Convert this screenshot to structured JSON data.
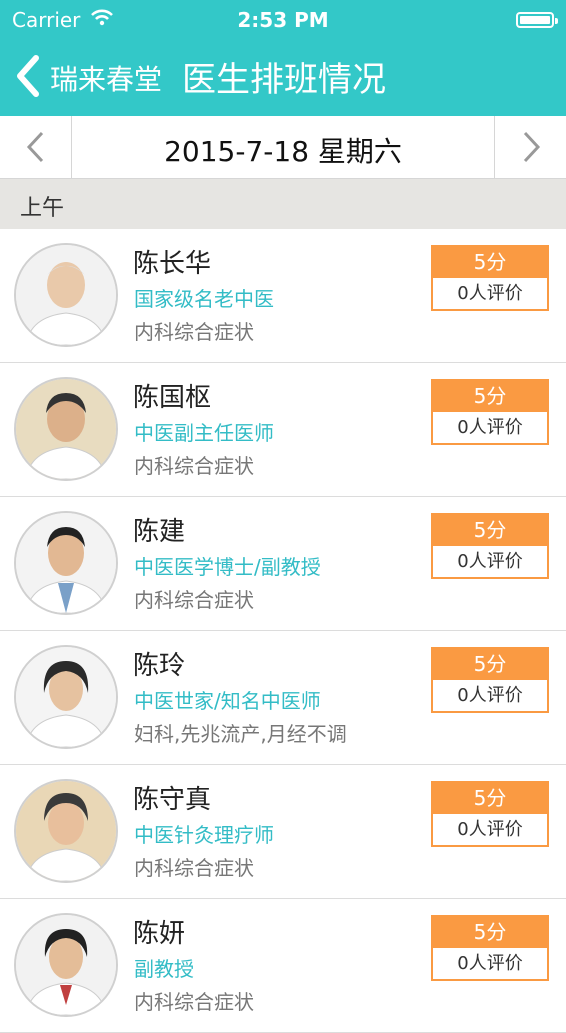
{
  "status_bar": {
    "carrier": "Carrier",
    "time": "2:53 PM"
  },
  "nav": {
    "back_label": "瑞来春堂",
    "title": "医生排班情况"
  },
  "date_bar": {
    "date": "2015-7-18 星期六"
  },
  "section": {
    "label": "上午"
  },
  "colors": {
    "header": "#33c8c8",
    "accent_text": "#33bcc6",
    "rating": "#fa9a42"
  },
  "doctors": [
    {
      "name": "陈长华",
      "title": "国家级名老中医",
      "specialty": "内科综合症状",
      "score": "5分",
      "reviews": "0人评价"
    },
    {
      "name": "陈国枢",
      "title": "中医副主任医师",
      "specialty": "内科综合症状",
      "score": "5分",
      "reviews": "0人评价"
    },
    {
      "name": "陈建",
      "title": "中医医学博士/副教授",
      "specialty": "内科综合症状",
      "score": "5分",
      "reviews": "0人评价"
    },
    {
      "name": "陈玲",
      "title": "中医世家/知名中医师",
      "specialty": "妇科,先兆流产,月经不调",
      "score": "5分",
      "reviews": "0人评价"
    },
    {
      "name": "陈守真",
      "title": "中医针灸理疗师",
      "specialty": "内科综合症状",
      "score": "5分",
      "reviews": "0人评价"
    },
    {
      "name": "陈妍",
      "title": "副教授",
      "specialty": "内科综合症状",
      "score": "5分",
      "reviews": "0人评价"
    }
  ]
}
